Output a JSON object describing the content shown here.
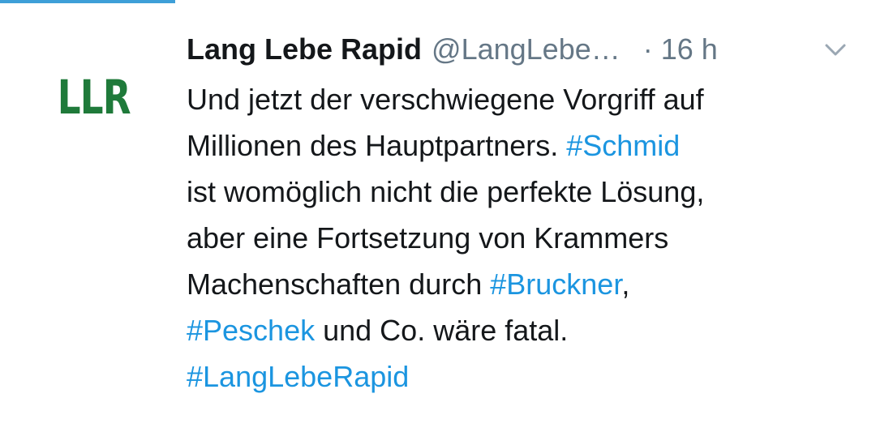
{
  "tweet": {
    "avatar_text": "LLR",
    "display_name": "Lang Lebe Rapid",
    "handle": "@LangLebe…",
    "separator": "·",
    "timestamp": "16 h",
    "menu_icon": "chevron-down-icon",
    "lines": {
      "l1": "Und jetzt der verschwiegene Vorgriff auf",
      "l2_text": "Millionen des Hauptpartners. ",
      "l2_tag": "#Schmid",
      "l3": "ist womöglich nicht die perfekte Lösung,",
      "l4": "aber eine Fortsetzung von Krammers",
      "l5_text": "Machenschaften durch ",
      "l5_tag": "#Bruckner",
      "l5_after": ",",
      "l6_tag": "#Peschek",
      "l6_text": " und Co. wäre fatal.",
      "l7_tag": "#LangLebeRapid"
    }
  },
  "colors": {
    "accent": "#3e9fd8",
    "hashtag": "#1b95e0",
    "avatar_green": "#1f7a3a",
    "text": "#14171a",
    "muted": "#657786"
  }
}
